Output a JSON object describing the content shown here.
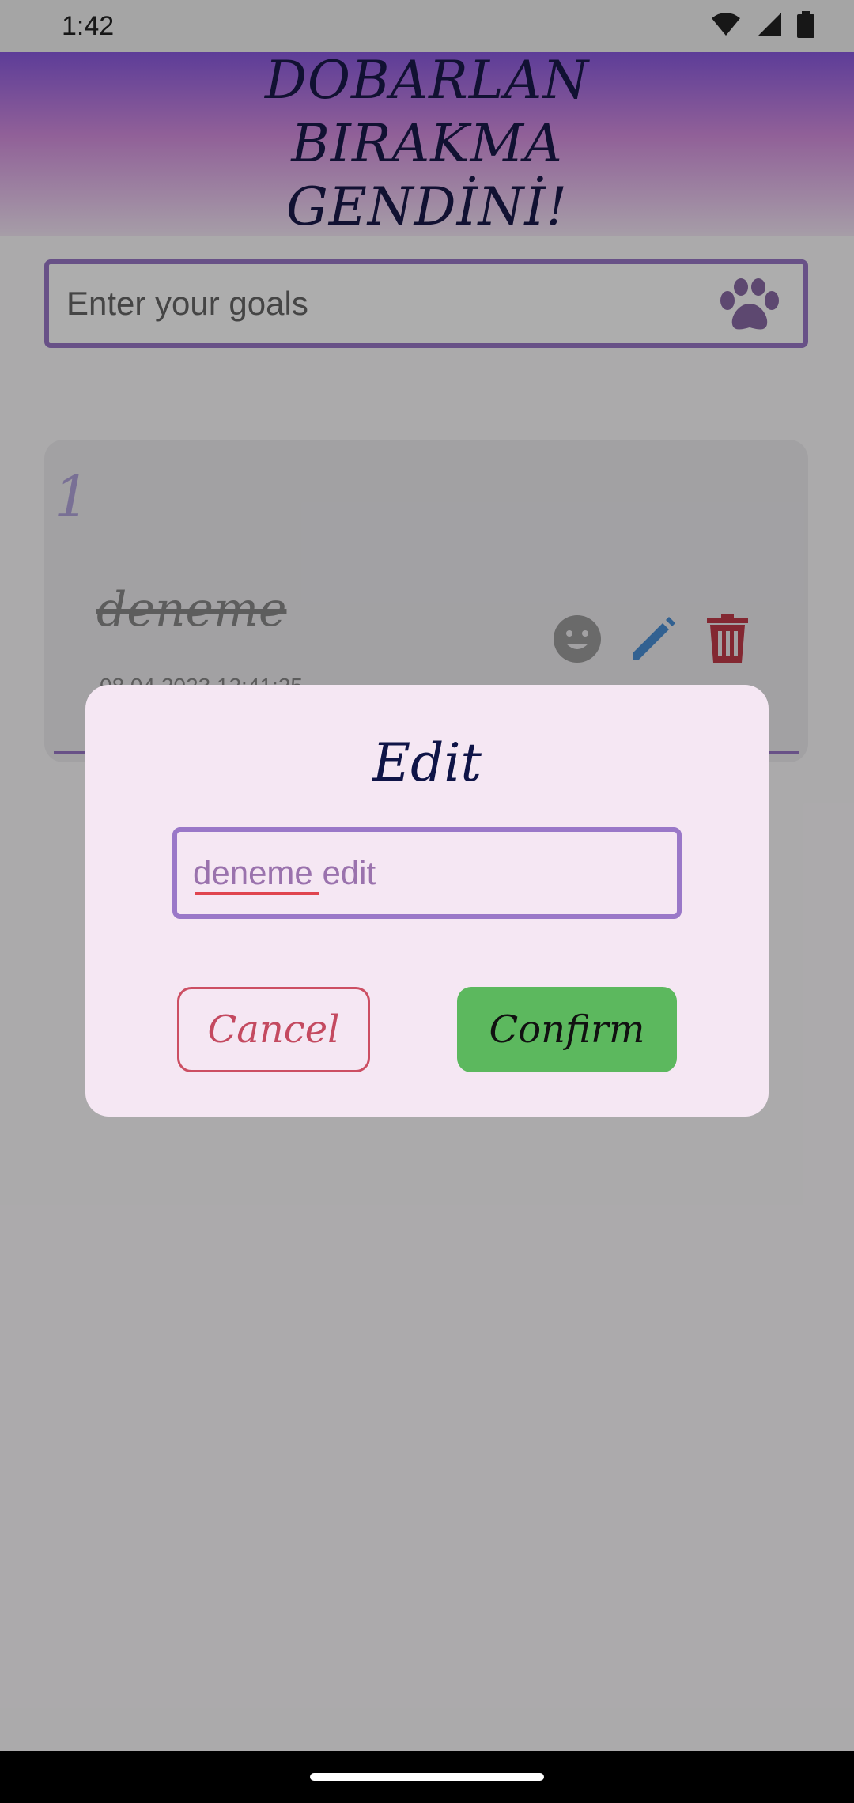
{
  "status_bar": {
    "time": "1:42",
    "icons": [
      "wifi-icon",
      "cellular-icon",
      "battery-icon"
    ]
  },
  "header": {
    "title": "DOBARLAN BIRAKMA GENDİNİ!"
  },
  "goal_input": {
    "placeholder": "Enter your goals",
    "icon": "paw-icon"
  },
  "goal_card": {
    "number": "1",
    "text": "deneme",
    "date": "08.04.2023 12:41:25",
    "actions": [
      "smiley-icon",
      "pencil-icon",
      "trash-icon"
    ]
  },
  "dialog": {
    "title": "Edit",
    "input_value": "deneme edit",
    "cancel_label": "Cancel",
    "confirm_label": "Confirm"
  },
  "colors": {
    "header_gradient_top": "#8a5ae0",
    "header_gradient_mid": "#d58ee0",
    "accent_purple": "#9a78c8",
    "confirm_green": "#5cb85e",
    "cancel_red": "#cc4f63",
    "dialog_bg": "#f5e7f3"
  }
}
